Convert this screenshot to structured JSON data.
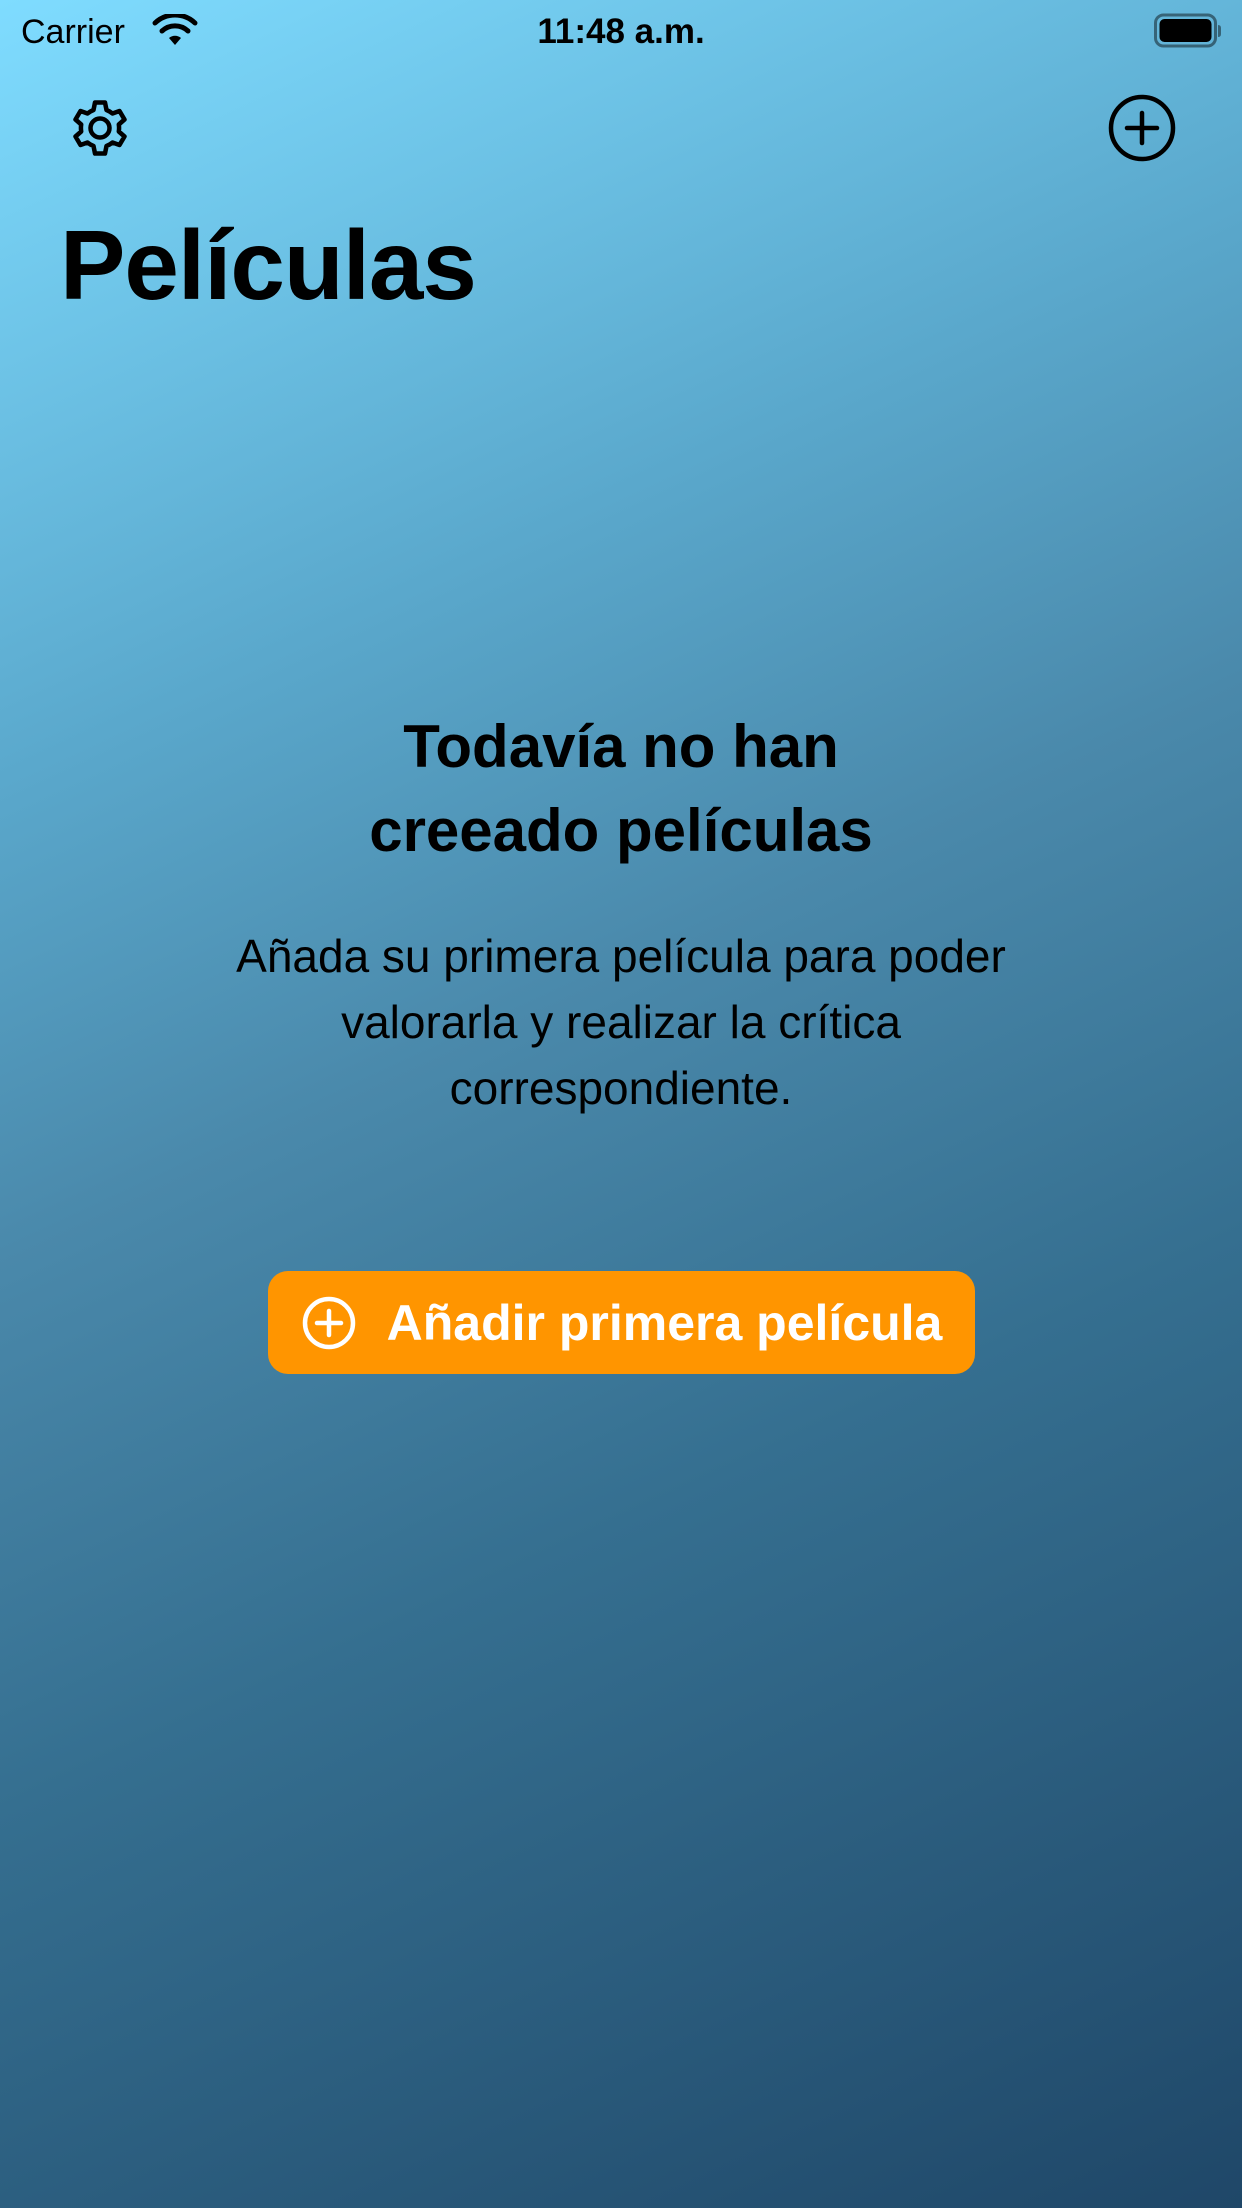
{
  "status_bar": {
    "carrier": "Carrier",
    "time": "11:48 a.m.",
    "icons": [
      "wifi-icon",
      "battery-icon"
    ]
  },
  "nav": {
    "left_icon": "gear-icon",
    "right_icon": "plus-circle-icon",
    "title": "Películas"
  },
  "empty_state": {
    "title": "Todavía no han\ncreeado películas",
    "subtitle": "Añada su primera película para poder\nvalorarla y realizar la crítica\ncorrespondiente.",
    "button_label": "Añadir primera película",
    "button_icon": "plus-circle-icon",
    "button_color": "#ff9500"
  },
  "colors": {
    "gradient_top": "#7fdcff",
    "gradient_bottom": "#1f4768"
  }
}
